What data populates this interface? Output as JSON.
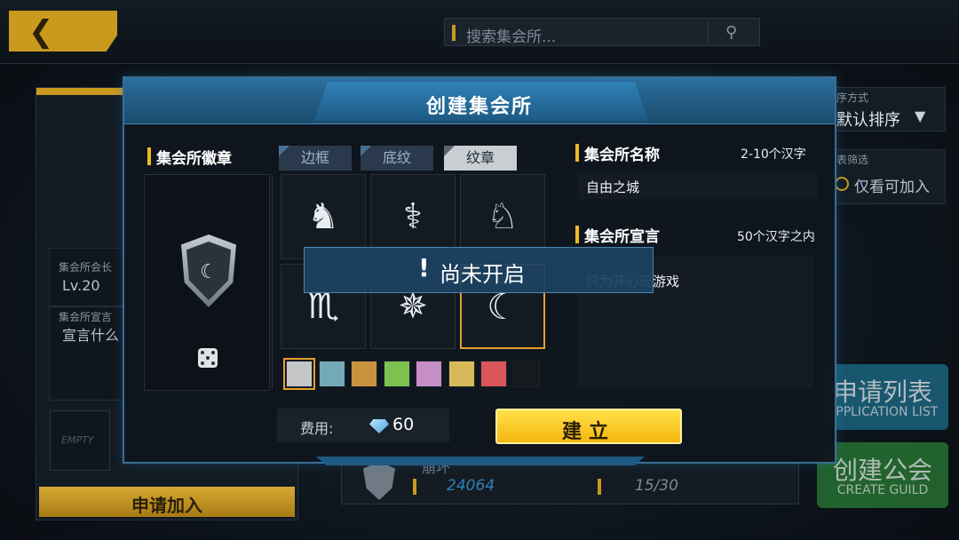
{
  "topbar": {
    "back_icon": "chevron-left-icon",
    "back_glyph": "❮",
    "search_placeholder": "搜索集会所...",
    "search_icon": "search-icon",
    "search_glyph": "⚲"
  },
  "background": {
    "left_panel": {
      "leader_label": "集会所会长",
      "leader_value": "Lv.20",
      "declaration_label": "集会所宣言",
      "declaration_value": "宣言什么",
      "empty_slot": "EMPTY",
      "apply_join": "申请加入"
    },
    "sort": {
      "label": "序方式",
      "value": "默认排序",
      "arrow": "▼"
    },
    "filter": {
      "label": "表筛选",
      "value": "仅看可加入"
    },
    "application_list": {
      "cn": "申请列表",
      "en": "APPLICATION LIST"
    },
    "create_guild": {
      "cn": "创建公会",
      "en": "CREATE GUILD"
    },
    "guild_card": {
      "name": "崩坏",
      "power": "24064",
      "members": "15/30"
    }
  },
  "modal": {
    "title": "创建集会所",
    "emblem_section": {
      "label": "集会所徽章"
    },
    "tabs": [
      {
        "label": "边框",
        "active": false
      },
      {
        "label": "底纹",
        "active": false
      },
      {
        "label": "纹章",
        "active": true
      }
    ],
    "emblem_glyphs": [
      "♞",
      "⚕",
      "♘",
      "♏",
      "✵",
      "☾"
    ],
    "selected_index": 5,
    "preview_glyph": "☾",
    "colors": [
      "#c4c6c8",
      "#73aab8",
      "#c9923e",
      "#7dc14f",
      "#c58ec6",
      "#d8b95a",
      "#d9555a",
      "#161a1e"
    ],
    "selected_color_index": 0,
    "name_section": {
      "label": "集会所名称",
      "hint": "2-10个汉字",
      "value": "自由之城"
    },
    "declaration_section": {
      "label": "集会所宣言",
      "hint": "50个汉字之内",
      "value": "只为开心玩游戏"
    },
    "fee": {
      "label": "费用:",
      "value": "60",
      "icon": "gem-icon"
    },
    "create_button": "建立"
  },
  "toast": {
    "icon": "exclamation-icon",
    "glyph": "!",
    "message": "尚未开启"
  }
}
